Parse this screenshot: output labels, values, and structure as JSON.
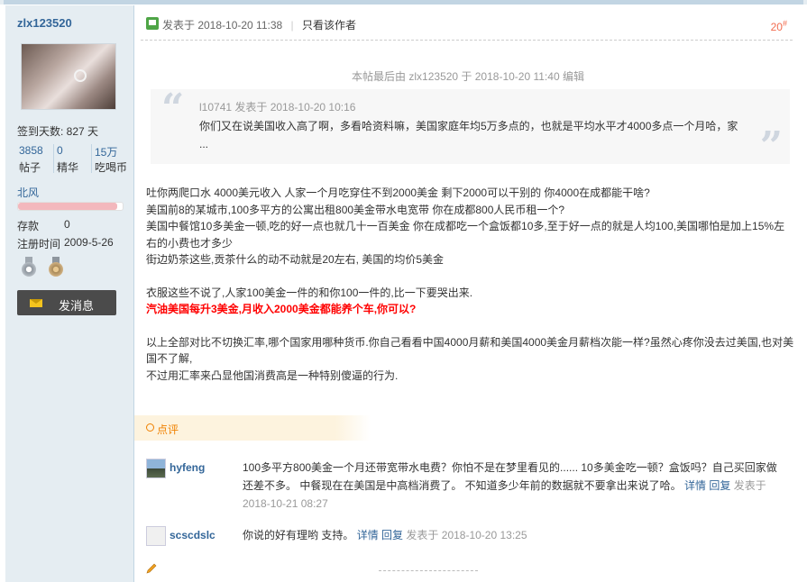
{
  "author": {
    "username": "zlx123520",
    "signin_days": "签到天数: 827 天",
    "stats": [
      {
        "num": "3858",
        "label": "帖子"
      },
      {
        "num": "0",
        "label": "精华"
      },
      {
        "num": "15万",
        "label": "吃喝币"
      }
    ],
    "group": "北风",
    "level_progress": 0.95,
    "credits_label": "存款",
    "credits_value": "0",
    "regtime_label": "注册时间",
    "regtime_value": "2009-5-26",
    "send_message": "发消息",
    "colors": {
      "link": "#336699",
      "sidebar_bg": "#e5edf2",
      "button_bg": "#4b4b4b"
    }
  },
  "post": {
    "posted": "发表于 2018-10-20 11:38",
    "only_author": "只看该作者",
    "floor": "20",
    "floor_mark": "#",
    "edited": "本帖最后由 zlx123520 于 2018-10-20 11:40 编辑",
    "quote": {
      "header": "l10741 发表于 2018-10-20 10:16",
      "text": "你们又在说美国收入高了啊，多看哈资料嘛，美国家庭年均5万多点的，也就是平均水平才4000多点一个月哈，家 ..."
    },
    "body": {
      "p1": "吐你两爬口水  4000美元收入  人家一个月吃穿住不到2000美金 剩下2000可以干别的 你4000在成都能干啥?",
      "p2": "美国前8的某城市,100多平方的公寓出租800美金带水电宽带 你在成都800人民币租一个?",
      "p3": "美国中餐馆10多美金一顿,吃的好一点也就几十一百美金  你在成都吃一个盒饭都10多,至于好一点的就是人均100,美国哪怕是加上15%左右的小费也才多少",
      "p4": "街边奶茶这些,贡茶什么的动不动就是20左右, 美国的均价5美金",
      "p5": "衣服这些不说了,人家100美金一件的和你100一件的,比一下要哭出来.",
      "p6": "汽油美国每升3美金,月收入2000美金都能养个车,你可以?",
      "p7": "以上全部对比不切换汇率,哪个国家用哪种货币.你自己看看中国4000月薪和美国4000美金月薪档次能一样?虽然心疼你没去过美国,也对美国不了解,",
      "p8": "不过用汇率来凸显他国消费高是一种特别傻逼的行为."
    },
    "comment_section": "点评",
    "comments": [
      {
        "user": "hyfeng",
        "text": "100多平方800美金一个月还带宽带水电费？你怕不是在梦里看见的...... 10多美金吃一顿？盒饭吗？自己买回家做还差不多。 中餐现在在美国是中高档消费了。 不知道多少年前的数据就不要拿出来说了哈。",
        "detail": "详情",
        "reply": "回复",
        "posted_prefix": "发表于",
        "posted_time": "2018-10-21 08:27"
      },
      {
        "user": "scscdslc",
        "text": "你说的好有理哟 支持。",
        "detail": "详情",
        "reply": "回复",
        "posted_prefix": "发表于",
        "posted_time": "2018-10-20 13:25"
      }
    ],
    "colors": {
      "floor": "#f26c4f",
      "highlight": "#ff0000",
      "comment_accent": "#f08000"
    }
  }
}
